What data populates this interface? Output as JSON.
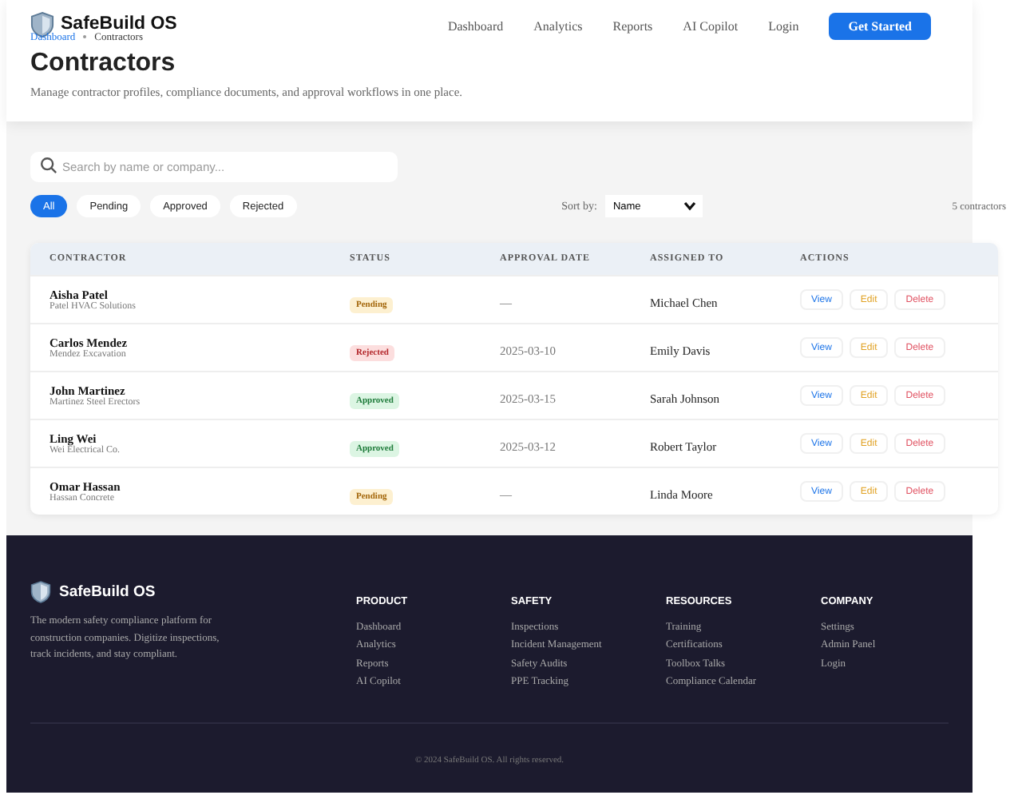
{
  "brand": {
    "name": "SafeBuild OS"
  },
  "nav": [
    {
      "label": "Dashboard"
    },
    {
      "label": "Analytics"
    },
    {
      "label": "Reports"
    },
    {
      "label": "AI Copilot"
    },
    {
      "label": "Login"
    }
  ],
  "cta": "Get Started",
  "breadcrumb": [
    "Dashboard",
    "Contractors"
  ],
  "page": {
    "title": "Contractors",
    "subtitle": "Manage contractor profiles, compliance documents, and approval workflows in one place."
  },
  "search": {
    "placeholder": "Search by name or company..."
  },
  "filters": [
    {
      "label": "All",
      "selected": true
    },
    {
      "label": "Pending",
      "selected": false
    },
    {
      "label": "Approved",
      "selected": false
    },
    {
      "label": "Rejected",
      "selected": false
    }
  ],
  "sort": {
    "label": "Sort by:",
    "value": "Name"
  },
  "count": "5 contractors",
  "table": {
    "columns": [
      "CONTRACTOR",
      "STATUS",
      "APPROVAL DATE",
      "ASSIGNED TO",
      "ACTIONS"
    ],
    "rows": [
      {
        "name": "Aisha Patel",
        "company": "Patel HVAC Solutions",
        "status": {
          "label": "Pending",
          "kind": "pending"
        },
        "date": "—",
        "assigned": "Michael Chen",
        "actions": [
          "View",
          "Edit",
          "Delete"
        ]
      },
      {
        "name": "Carlos Mendez",
        "company": "Mendez Excavation",
        "status": {
          "label": "Rejected",
          "kind": "rejected"
        },
        "date": "2025-03-10",
        "assigned": "Emily Davis",
        "actions": [
          "View",
          "Edit",
          "Delete"
        ]
      },
      {
        "name": "John Martinez",
        "company": "Martinez Steel Erectors",
        "status": {
          "label": "Approved",
          "kind": "approved"
        },
        "date": "2025-03-15",
        "assigned": "Sarah Johnson",
        "actions": [
          "View",
          "Edit",
          "Delete"
        ]
      },
      {
        "name": "Ling Wei",
        "company": "Wei Electrical Co.",
        "status": {
          "label": "Approved",
          "kind": "approved"
        },
        "date": "2025-03-12",
        "assigned": "Robert Taylor",
        "actions": [
          "View",
          "Edit",
          "Delete"
        ]
      },
      {
        "name": "Omar Hassan",
        "company": "Hassan Concrete",
        "status": {
          "label": "Pending",
          "kind": "pending"
        },
        "date": "—",
        "assigned": "Linda Moore",
        "actions": [
          "View",
          "Edit",
          "Delete"
        ]
      }
    ]
  },
  "footer": {
    "brand": "SafeBuild OS",
    "tagline": "The modern safety compliance platform for construction companies. Digitize inspections, track incidents, and stay compliant.",
    "columns": [
      {
        "heading": "PRODUCT",
        "links": [
          "Dashboard",
          "Analytics",
          "Reports",
          "AI Copilot"
        ]
      },
      {
        "heading": "SAFETY",
        "links": [
          "Inspections",
          "Incident Management",
          "Safety Audits",
          "PPE Tracking"
        ]
      },
      {
        "heading": "RESOURCES",
        "links": [
          "Training",
          "Certifications",
          "Toolbox Talks",
          "Compliance Calendar"
        ]
      },
      {
        "heading": "COMPANY",
        "links": [
          "Settings",
          "Admin Panel",
          "Login"
        ]
      }
    ],
    "copyright": "© 2024 SafeBuild OS. All rights reserved."
  }
}
